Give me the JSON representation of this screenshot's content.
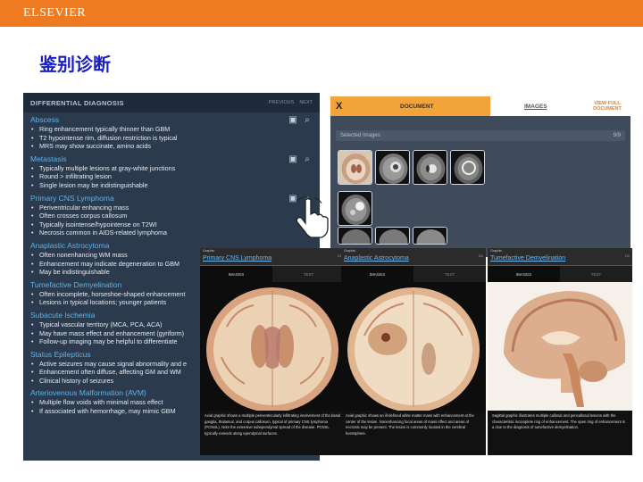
{
  "brand": {
    "name": "ELSEVIER",
    "bar_color": "#ee7b21"
  },
  "slide": {
    "title": "鉴别诊断"
  },
  "ddx_panel": {
    "title": "DIFFERENTIAL DIAGNOSIS",
    "nav": {
      "previous": "PREVIOUS",
      "next": "NEXT"
    },
    "items": [
      {
        "name": "Abscess",
        "icons": true,
        "bullets": [
          "Ring enhancement typically thinner than GBM",
          "T2 hypointense rim, diffusion restriction is typical",
          "MRS may show succinate, amino acids"
        ]
      },
      {
        "name": "Metastasis",
        "icons": true,
        "bullets": [
          "Typically multiple lesions at gray-white junctions",
          "Round > infiltrating lesion",
          "Single lesion may be indistinguishable"
        ]
      },
      {
        "name": "Primary CNS Lymphoma",
        "icons": true,
        "bullets": [
          "Periventricular enhancing mass",
          "Often crosses corpus callosum",
          "Typically isointense/hypointense on T2WI",
          "Necrosis common in AIDS-related lymphoma"
        ]
      },
      {
        "name": "Anaplastic Astrocytoma",
        "icons": false,
        "bullets": [
          "Often nonenhancing WM mass",
          "Enhancement may indicate degeneration to GBM",
          "May be indistinguishable"
        ]
      },
      {
        "name": "Tumefactive Demyelination",
        "icons": false,
        "bullets": [
          "Often incomplete, horseshoe-shaped enhancement",
          "Lesions in typical locations; younger patients"
        ]
      },
      {
        "name": "Subacute Ischemia",
        "icons": false,
        "bullets": [
          "Typical vascular territory (MCA, PCA, ACA)",
          "May have mass effect and enhancement (gyriform)",
          "Follow-up imaging may be helpful to differentiate"
        ]
      },
      {
        "name": "Status Epilepticus",
        "icons": false,
        "bullets": [
          "Active seizures may cause signal abnormality and e",
          "Enhancement often diffuse, affecting GM and WM",
          "Clinical history of seizures"
        ]
      },
      {
        "name": "Arteriovenous Malformation (AVM)",
        "icons": false,
        "bullets": [
          "Multiple flow voids with minimal mass effect",
          "If associated with hemorrhage, may mimic GBM"
        ]
      }
    ]
  },
  "viewer": {
    "close_label": "X",
    "tab_document": "DOCUMENT",
    "tab_images": "IMAGES",
    "view_full": "VIEW FULL DOCUMENT",
    "selected_images": "Selected Images",
    "selected_count": "9/9"
  },
  "cards": [
    {
      "kicker": "Graphic",
      "title": "Primary CNS Lymphoma",
      "page": "1/1",
      "tab_images": "IMAGES",
      "tab_text": "TEXT",
      "caption": "Axial graphic shows a multiple periventricularly infiltrating involvement of the basal ganglia, thalamus, and corpus callosum, typical of primary CNS lymphoma (PCNSL). Note the extensive subependymal spread of the disease. PCNSL typically extends along ependymal surfaces."
    },
    {
      "kicker": "Graphic",
      "title": "Anaplastic Astrocytoma",
      "page": "1/1",
      "tab_images": "IMAGES",
      "tab_text": "TEXT",
      "caption": "Axial graphic shows an ill-defined white matter mass with enhancement at the center of the lesion. Nonenhancing focal areas of mass effect and areas of necrosis may be present. The lesion is commonly located in the cerebral hemisphere."
    },
    {
      "kicker": "Graphic",
      "title": "Tumefactive Demyelination",
      "page": "1/1",
      "tab_images": "IMAGES",
      "tab_text": "TEXT",
      "caption": "Sagittal graphic illustrates multiple callosal and pericallosal lesions with the characteristic incomplete ring of enhancement. The open ring of enhancement is a clue to the diagnosis of tumefactive demyelination."
    }
  ]
}
